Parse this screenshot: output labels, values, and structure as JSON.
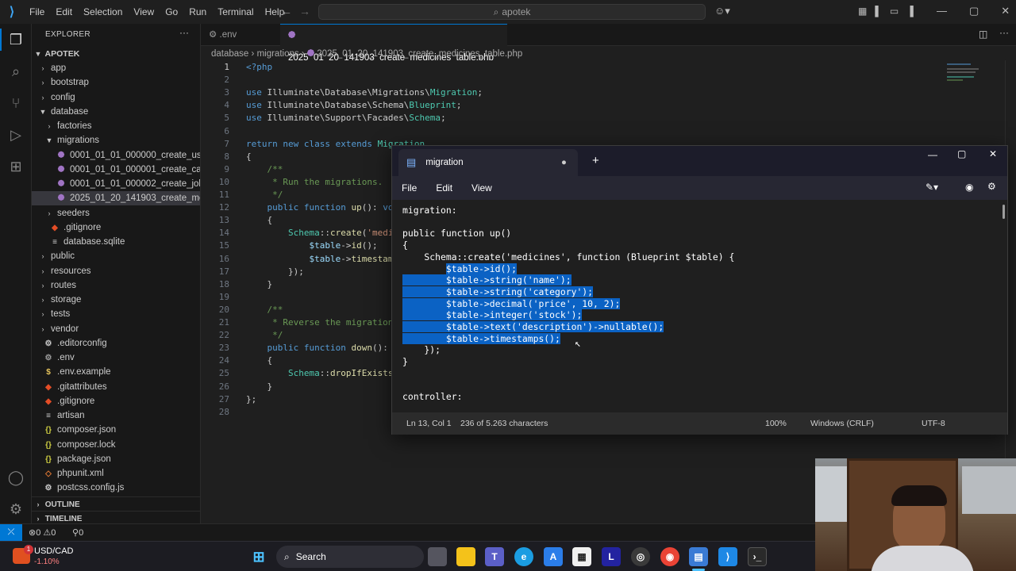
{
  "titlebar": {
    "menu": [
      "File",
      "Edit",
      "Selection",
      "View",
      "Go",
      "Run",
      "Terminal",
      "Help"
    ],
    "search": "apotek"
  },
  "sidebar": {
    "header": "EXPLORER",
    "project": "APOTEK",
    "items": [
      {
        "label": "app",
        "indent": 1,
        "type": "folder",
        "open": false
      },
      {
        "label": "bootstrap",
        "indent": 1,
        "type": "folder",
        "open": false
      },
      {
        "label": "config",
        "indent": 1,
        "type": "folder",
        "open": false
      },
      {
        "label": "database",
        "indent": 1,
        "type": "folder",
        "open": true
      },
      {
        "label": "factories",
        "indent": 2,
        "type": "folder",
        "open": false
      },
      {
        "label": "migrations",
        "indent": 2,
        "type": "folder",
        "open": true
      },
      {
        "label": "0001_01_01_000000_create_users_...",
        "indent": 3,
        "type": "php"
      },
      {
        "label": "0001_01_01_000001_create_cache...",
        "indent": 3,
        "type": "php"
      },
      {
        "label": "0001_01_01_000002_create_jobs_t...",
        "indent": 3,
        "type": "php"
      },
      {
        "label": "2025_01_20_141903_create_medic...",
        "indent": 3,
        "type": "php",
        "selected": true
      },
      {
        "label": "seeders",
        "indent": 2,
        "type": "folder",
        "open": false
      },
      {
        "label": ".gitignore",
        "indent": 2,
        "type": "git"
      },
      {
        "label": "database.sqlite",
        "indent": 2,
        "type": "db"
      },
      {
        "label": "public",
        "indent": 1,
        "type": "folder",
        "open": false
      },
      {
        "label": "resources",
        "indent": 1,
        "type": "folder",
        "open": false
      },
      {
        "label": "routes",
        "indent": 1,
        "type": "folder",
        "open": false
      },
      {
        "label": "storage",
        "indent": 1,
        "type": "folder",
        "open": false
      },
      {
        "label": "tests",
        "indent": 1,
        "type": "folder",
        "open": false
      },
      {
        "label": "vendor",
        "indent": 1,
        "type": "folder",
        "open": false
      },
      {
        "label": ".editorconfig",
        "indent": 1,
        "type": "cfg"
      },
      {
        "label": ".env",
        "indent": 1,
        "type": "env"
      },
      {
        "label": ".env.example",
        "indent": 1,
        "type": "dollar"
      },
      {
        "label": ".gitattributes",
        "indent": 1,
        "type": "git"
      },
      {
        "label": ".gitignore",
        "indent": 1,
        "type": "git"
      },
      {
        "label": "artisan",
        "indent": 1,
        "type": "plain"
      },
      {
        "label": "composer.json",
        "indent": 1,
        "type": "json"
      },
      {
        "label": "composer.lock",
        "indent": 1,
        "type": "json"
      },
      {
        "label": "package.json",
        "indent": 1,
        "type": "json"
      },
      {
        "label": "phpunit.xml",
        "indent": 1,
        "type": "xml"
      },
      {
        "label": "postcss.config.js",
        "indent": 1,
        "type": "js"
      }
    ],
    "outline": "OUTLINE",
    "timeline": "TIMELINE"
  },
  "tabs": [
    ".env",
    "2025_01_20_141903_create_medicines_table.php"
  ],
  "breadcrumb": [
    "database",
    "migrations",
    "2025_01_20_141903_create_medicines_table.php"
  ],
  "editor": {
    "line_numbers": [
      "1",
      "2",
      "3",
      "4",
      "5",
      "6",
      "7",
      "8",
      "9",
      "10",
      "11",
      "12",
      "13",
      "14",
      "15",
      "16",
      "17",
      "18",
      "19",
      "20",
      "21",
      "22",
      "23",
      "24",
      "25",
      "26",
      "27",
      "28"
    ],
    "lines": [
      [
        [
          "kw",
          "<?php"
        ]
      ],
      [],
      [
        [
          "kw",
          "use "
        ],
        [
          "",
          "Illuminate\\Database\\Migrations\\"
        ],
        [
          "cls",
          "Migration"
        ],
        [
          "",
          ";"
        ]
      ],
      [
        [
          "kw",
          "use "
        ],
        [
          "",
          "Illuminate\\Database\\Schema\\"
        ],
        [
          "cls",
          "Blueprint"
        ],
        [
          "",
          ";"
        ]
      ],
      [
        [
          "kw",
          "use "
        ],
        [
          "",
          "Illuminate\\Support\\Facades\\"
        ],
        [
          "cls",
          "Schema"
        ],
        [
          "",
          ";"
        ]
      ],
      [],
      [
        [
          "kw",
          "return new class extends "
        ],
        [
          "cls",
          "Migration"
        ]
      ],
      [
        [
          "",
          "{"
        ]
      ],
      [
        [
          "cm",
          "    /**"
        ]
      ],
      [
        [
          "cm",
          "     * Run the migrations."
        ]
      ],
      [
        [
          "cm",
          "     */"
        ]
      ],
      [
        [
          "kw",
          "    public function "
        ],
        [
          "fn",
          "up"
        ],
        [
          "",
          "(): "
        ],
        [
          "kw",
          "vo"
        ]
      ],
      [
        [
          "",
          "    {"
        ]
      ],
      [
        [
          "cls",
          "        Schema"
        ],
        [
          "",
          "::"
        ],
        [
          "fn",
          "create"
        ],
        [
          "",
          "("
        ],
        [
          "str",
          "'medic"
        ]
      ],
      [
        [
          "var",
          "            $table"
        ],
        [
          "",
          "->"
        ],
        [
          "fn",
          "id"
        ],
        [
          "",
          "();"
        ]
      ],
      [
        [
          "var",
          "            $table"
        ],
        [
          "",
          "->"
        ],
        [
          "fn",
          "timestamp"
        ]
      ],
      [
        [
          "",
          "        });"
        ]
      ],
      [
        [
          "",
          "    }"
        ]
      ],
      [],
      [
        [
          "cm",
          "    /**"
        ]
      ],
      [
        [
          "cm",
          "     * Reverse the migrations"
        ]
      ],
      [
        [
          "cm",
          "     */"
        ]
      ],
      [
        [
          "kw",
          "    public function "
        ],
        [
          "fn",
          "down"
        ],
        [
          "",
          "(): "
        ],
        [
          "kw",
          "v"
        ]
      ],
      [
        [
          "",
          "    {"
        ]
      ],
      [
        [
          "cls",
          "        Schema"
        ],
        [
          "",
          "::"
        ],
        [
          "fn",
          "dropIfExists"
        ],
        [
          "",
          "("
        ]
      ],
      [
        [
          "",
          "    }"
        ]
      ],
      [
        [
          "",
          "};"
        ]
      ],
      []
    ]
  },
  "notepad": {
    "tab_title": "migration",
    "menu": [
      "File",
      "Edit",
      "View"
    ],
    "lines": [
      {
        "text": "migration:",
        "hl_from": -1
      },
      {
        "text": "",
        "hl_from": -1
      },
      {
        "text": "public function up()",
        "hl_from": -1
      },
      {
        "text": "{",
        "hl_from": -1
      },
      {
        "text": "    Schema::create('medicines', function (Blueprint $table) {",
        "hl_from": -1
      },
      {
        "text": "        $table->id();",
        "hl_from": 8,
        "hl_full": false
      },
      {
        "text": "        $table->string('name');",
        "hl_from": 0
      },
      {
        "text": "        $table->string('category');",
        "hl_from": 0
      },
      {
        "text": "        $table->decimal('price', 10, 2);",
        "hl_from": 0
      },
      {
        "text": "        $table->integer('stock');",
        "hl_from": 0
      },
      {
        "text": "        $table->text('description')->nullable();",
        "hl_from": 0
      },
      {
        "text": "        $table->timestamps();",
        "hl_from": 0
      },
      {
        "text": "    });",
        "hl_from": -1
      },
      {
        "text": "}",
        "hl_from": -1
      },
      {
        "text": "",
        "hl_from": -1
      },
      {
        "text": "",
        "hl_from": -1
      },
      {
        "text": "controller:",
        "hl_from": -1
      }
    ],
    "status": {
      "position": "Ln 13, Col 1",
      "chars": "236 of 5.263 characters",
      "zoom": "100%",
      "eol": "Windows (CRLF)",
      "encoding": "UTF-8"
    }
  },
  "statusbar": {
    "errors": "0",
    "warnings": "0",
    "ports": "0"
  },
  "taskbar": {
    "ticker": "USD/CAD",
    "change": "-1.10%",
    "badge": "1",
    "search": "Search"
  },
  "colors": {
    "accent": "#0078d4",
    "highlight": "#0b62c4",
    "remote": "#0078d4"
  }
}
